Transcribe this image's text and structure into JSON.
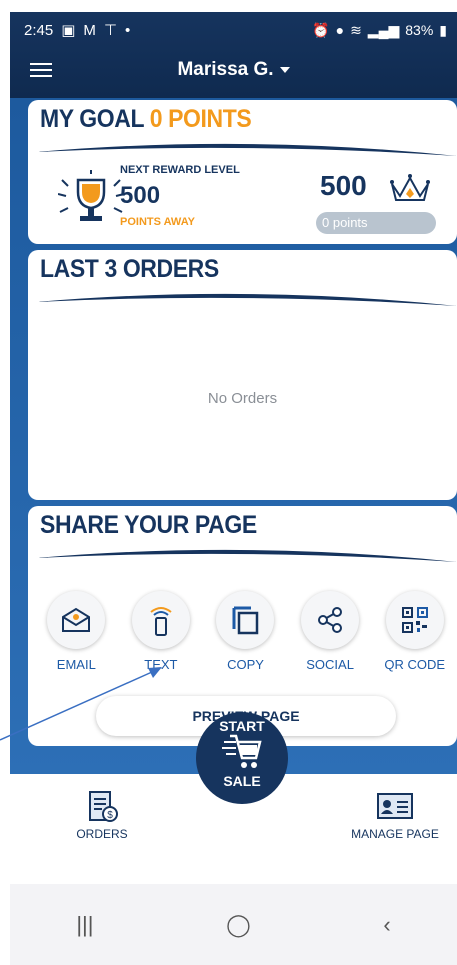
{
  "status_bar": {
    "time": "2:45",
    "battery": "83%",
    "left_icons": [
      "image-icon",
      "gmail-icon",
      "antenna-icon",
      "dot-icon"
    ],
    "right_icons": [
      "alarm-icon",
      "location-icon",
      "wifi-icon",
      "signal-icon",
      "battery-icon"
    ]
  },
  "header": {
    "username": "Marissa G."
  },
  "goal": {
    "title_a": "MY GOAL",
    "title_b": "0 POINTS",
    "next_level_label": "NEXT REWARD LEVEL",
    "next_level_points": "500",
    "points_away": "POINTS AWAY",
    "goal_points": "500",
    "progress_text": "0 points",
    "progress_fraction": 0
  },
  "orders": {
    "title": "LAST 3 ORDERS",
    "empty": "No Orders"
  },
  "share": {
    "title": "SHARE YOUR PAGE",
    "items": [
      {
        "label": "EMAIL",
        "icon": "email-icon"
      },
      {
        "label": "TEXT",
        "icon": "phone-icon"
      },
      {
        "label": "COPY",
        "icon": "copy-icon"
      },
      {
        "label": "SOCIAL",
        "icon": "share-icon"
      },
      {
        "label": "QR CODE",
        "icon": "qr-icon"
      }
    ],
    "preview": "PREVIEW PAGE"
  },
  "start_sale": {
    "line1": "START",
    "line2": "SALE"
  },
  "bottom_nav": {
    "orders": "ORDERS",
    "manage": "MANAGE PAGE"
  },
  "colors": {
    "navy": "#16345e",
    "orange": "#f39a1d",
    "blue": "#1d5aa6"
  }
}
